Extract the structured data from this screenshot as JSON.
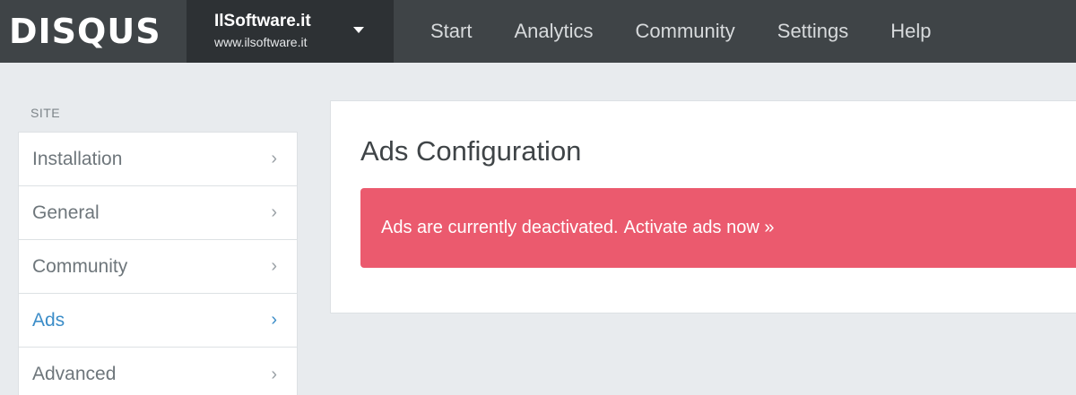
{
  "brand": {
    "logo_text": "DISQUS"
  },
  "site_switcher": {
    "name": "IlSoftware.it",
    "url": "www.ilsoftware.it"
  },
  "nav": {
    "items": [
      "Start",
      "Analytics",
      "Community",
      "Settings",
      "Help"
    ]
  },
  "sidebar": {
    "section_label": "SITE",
    "items": [
      {
        "label": "Installation",
        "active": false
      },
      {
        "label": "General",
        "active": false
      },
      {
        "label": "Community",
        "active": false
      },
      {
        "label": "Ads",
        "active": true
      },
      {
        "label": "Advanced",
        "active": false
      }
    ],
    "chevron": "›"
  },
  "main": {
    "title": "Ads Configuration",
    "alert": {
      "text": "Ads are currently deactivated.",
      "link": "Activate ads now »",
      "color": "#eb5a6e"
    }
  },
  "colors": {
    "topbar": "#3f4447",
    "site_switcher": "#2d3134",
    "active_link": "#3c8dc8",
    "background": "#e8ebee"
  }
}
